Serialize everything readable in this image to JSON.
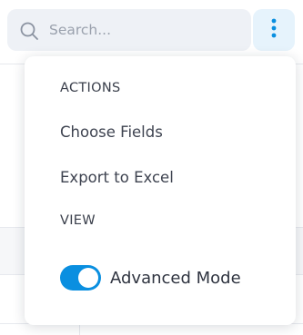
{
  "search": {
    "placeholder": "Search..."
  },
  "icons": {
    "search": "search-icon",
    "more": "vertical-ellipsis-icon"
  },
  "menu": {
    "sections": [
      {
        "heading": "ACTIONS",
        "items": [
          "Choose Fields",
          "Export to Excel"
        ]
      },
      {
        "heading": "VIEW",
        "toggle": {
          "label": "Advanced Mode",
          "checked": true
        }
      }
    ]
  },
  "colors": {
    "accent": "#0a8fe0",
    "search_bg": "#eef1f6",
    "more_button_bg": "#e6f3fc",
    "text": "#3e4350",
    "placeholder": "#9aa1ad"
  }
}
